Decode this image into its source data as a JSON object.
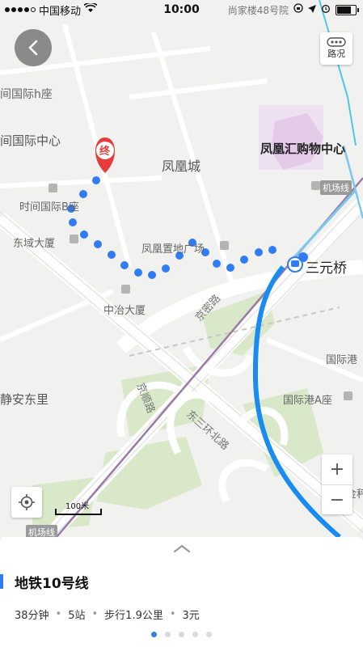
{
  "status_bar": {
    "carrier": "中国移动",
    "time": "10:00",
    "street_label": "尚家楼48号院",
    "battery_level": 0.85
  },
  "map": {
    "labels": {
      "shijian_h": "间国际h座",
      "shijian_center": "间国际中心",
      "fenghuang_cheng": "凤凰城",
      "fenghuang_mall": "凤凰汇购物中心",
      "shijian_b": "时间国际B座",
      "dongyu": "东域大厦",
      "fenghuang_plaza": "凤凰置地广场",
      "sanyuanqiao": "三元桥",
      "zhongye": "中冶大厦",
      "jingmi_road": "京密路",
      "jingshun_road": "京顺路",
      "east_3rd_ring": "东三环北路",
      "jing_an_dongli": "静安东里",
      "guoji_gang_a": "国际港A座",
      "guoji_gang_edge": "国际港",
      "edge_right": "金秤",
      "airport_line_top": "机场线",
      "airport_line_bottom": "机场线",
      "end_marker": "终"
    },
    "traffic_label": "路况",
    "zoom_in": "+",
    "zoom_out": "−",
    "scale": "100米",
    "colors": {
      "walk_dots": "#2f7cf5",
      "subway_line": "#1a8bf0",
      "end_marker": "#e83b3b",
      "airport_line": "#9a7aa6"
    }
  },
  "sheet": {
    "title": "地铁10号线",
    "duration": "38分钟",
    "stations": "5站",
    "walk": "步行1.9公里",
    "price": "3元",
    "page_index": 0,
    "page_count": 5
  }
}
